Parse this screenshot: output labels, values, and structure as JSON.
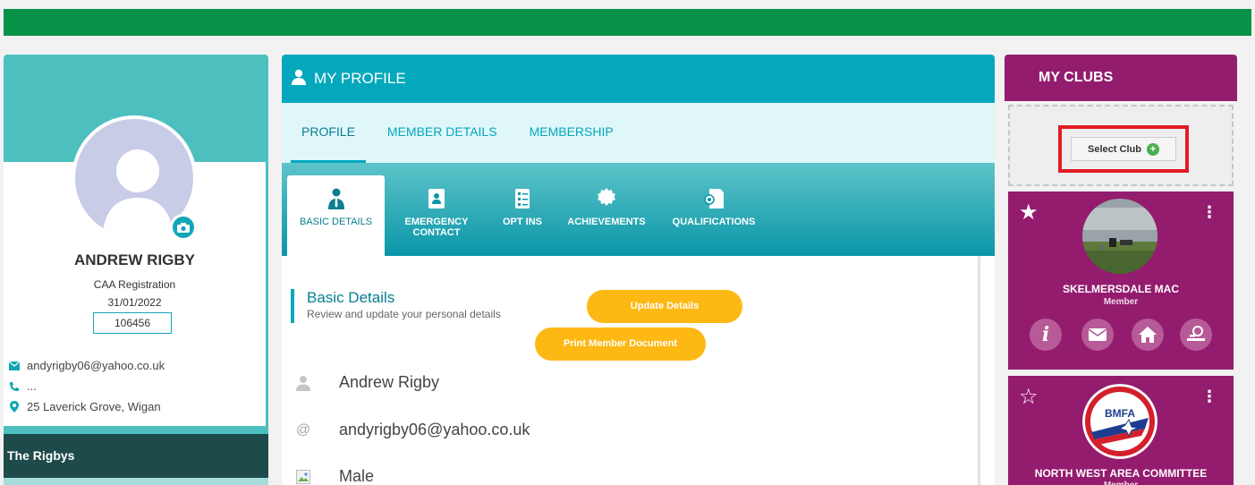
{
  "profile": {
    "name": "ANDREW RIGBY",
    "registration_label": "CAA Registration",
    "registration_date": "31/01/2022",
    "member_number": "106456",
    "email": "andyrigby06@yahoo.co.uk",
    "phone": "...",
    "address": "25 Laverick Grove, Wigan",
    "family": "The Rigbys"
  },
  "main": {
    "header_title": "MY PROFILE",
    "tabs": [
      {
        "label": "PROFILE",
        "active": true
      },
      {
        "label": "MEMBER DETAILS",
        "active": false
      },
      {
        "label": "MEMBERSHIP",
        "active": false
      }
    ],
    "subtabs": [
      {
        "label": "BASIC DETAILS",
        "icon": "person-tie-icon",
        "active": true
      },
      {
        "label": "EMERGENCY CONTACT",
        "icon": "contact-book-icon",
        "active": false
      },
      {
        "label": "OPT INS",
        "icon": "checklist-icon",
        "active": false
      },
      {
        "label": "ACHIEVEMENTS",
        "icon": "badge-icon",
        "active": false
      },
      {
        "label": "QUALIFICATIONS",
        "icon": "certificate-icon",
        "active": false
      }
    ],
    "section_title": "Basic Details",
    "section_subtitle": "Review and update your personal details",
    "update_button": "Update Details",
    "print_button": "Print Member Document",
    "fields": {
      "name": "Andrew Rigby",
      "email": "andyrigby06@yahoo.co.uk",
      "gender": "Male"
    }
  },
  "clubs": {
    "header": "MY CLUBS",
    "select_label": "Select Club",
    "list": [
      {
        "name": "SKELMERSDALE MAC",
        "role": "Member",
        "favorite": true
      },
      {
        "name": "NORTH WEST AREA COMMITTEE",
        "role": "Member",
        "favorite": false
      }
    ],
    "logo_text": "BMFA"
  },
  "colors": {
    "topbar": "#079247",
    "teal": "#04a8bc",
    "purple": "#941c6f",
    "yellow": "#fdb813",
    "highlight": "#e21b23"
  }
}
